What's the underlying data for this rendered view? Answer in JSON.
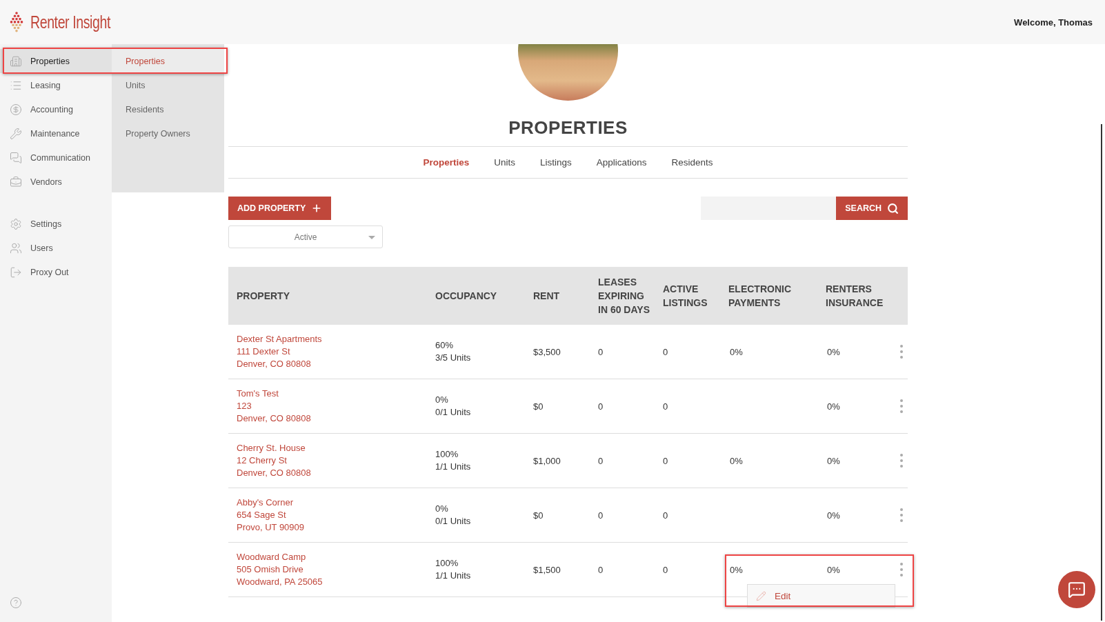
{
  "header": {
    "logo_text": "Renter Insight",
    "welcome": "Welcome, Thomas"
  },
  "sidebar": {
    "items": [
      {
        "label": "Properties",
        "selected": true
      },
      {
        "label": "Leasing",
        "selected": false
      },
      {
        "label": "Accounting",
        "selected": false
      },
      {
        "label": "Maintenance",
        "selected": false
      },
      {
        "label": "Communication",
        "selected": false
      },
      {
        "label": "Vendors",
        "selected": false
      },
      {
        "label": "Settings",
        "selected": false
      },
      {
        "label": "Users",
        "selected": false
      },
      {
        "label": "Proxy Out",
        "selected": false
      }
    ]
  },
  "submenu": {
    "items": [
      {
        "label": "Properties",
        "selected": true
      },
      {
        "label": "Units",
        "selected": false
      },
      {
        "label": "Residents",
        "selected": false
      },
      {
        "label": "Property Owners",
        "selected": false
      }
    ]
  },
  "page": {
    "title": "PROPERTIES"
  },
  "tabs": [
    {
      "label": "Properties",
      "selected": true
    },
    {
      "label": "Units",
      "selected": false
    },
    {
      "label": "Listings",
      "selected": false
    },
    {
      "label": "Applications",
      "selected": false
    },
    {
      "label": "Residents",
      "selected": false
    }
  ],
  "toolbar": {
    "add_button": "ADD PROPERTY",
    "search_button": "SEARCH",
    "status_filter": "Active"
  },
  "table": {
    "columns": [
      "PROPERTY",
      "OCCUPANCY",
      "RENT",
      "LEASES EXPIRING IN 60 DAYS",
      "ACTIVE LISTINGS",
      "ELECTRONIC PAYMENTS",
      "RENTERS INSURANCE"
    ],
    "rows": [
      {
        "property": [
          "Dexter St Apartments",
          "111 Dexter St",
          "Denver, CO 80808"
        ],
        "occupancy": [
          "60%",
          "3/5 Units"
        ],
        "rent": "$3,500",
        "leases_expiring": "0",
        "active_listings": "0",
        "electronic_payments": "0%",
        "renters_insurance": "0%"
      },
      {
        "property": [
          "Tom's Test",
          "123",
          "Denver, CO 80808"
        ],
        "occupancy": [
          "0%",
          "0/1 Units"
        ],
        "rent": "$0",
        "leases_expiring": "0",
        "active_listings": "0",
        "renters_insurance": "0%"
      },
      {
        "property": [
          "Cherry St. House",
          "12 Cherry St",
          "Denver, CO 80808"
        ],
        "occupancy": [
          "100%",
          "1/1 Units"
        ],
        "rent": "$1,000",
        "leases_expiring": "0",
        "active_listings": "0",
        "electronic_payments": "0%",
        "renters_insurance": "0%"
      },
      {
        "property": [
          "Abby's Corner",
          "654 Sage St",
          "Provo, UT 90909"
        ],
        "occupancy": [
          "0%",
          "0/1 Units"
        ],
        "rent": "$0",
        "leases_expiring": "0",
        "active_listings": "0",
        "renters_insurance": "0%"
      },
      {
        "property": [
          "Woodward Camp",
          "505 Omish Drive",
          "Woodward, PA 25065"
        ],
        "occupancy": [
          "100%",
          "1/1 Units"
        ],
        "rent": "$1,500",
        "leases_expiring": "0",
        "active_listings": "0",
        "electronic_payments": "0%",
        "renters_insurance": "0%",
        "menu_items": [
          "Edit"
        ]
      }
    ]
  }
}
